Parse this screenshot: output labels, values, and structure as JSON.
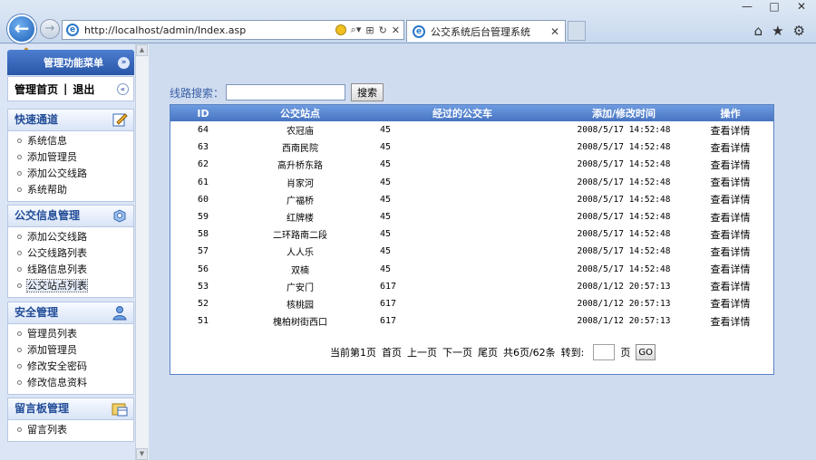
{
  "browser": {
    "address": "http://localhost/admin/Index.asp",
    "tab_title": "公交系统后台管理系统",
    "win_minimize": "—",
    "win_maximize": "□",
    "win_close": "✕"
  },
  "sidebar": {
    "menu_title": "管理功能菜单",
    "home_link": "管理首页",
    "link_separator": "|",
    "logout_link": "退出",
    "groups": [
      {
        "title": "快速通道",
        "items": [
          "系统信息",
          "添加管理员",
          "添加公交线路",
          "系统帮助"
        ]
      },
      {
        "title": "公交信息管理",
        "items": [
          "添加公交线路",
          "公交线路列表",
          "线路信息列表",
          "公交站点列表"
        ]
      },
      {
        "title": "安全管理",
        "items": [
          "管理员列表",
          "添加管理员",
          "修改安全密码",
          "修改信息资料"
        ]
      },
      {
        "title": "留言板管理",
        "items": [
          "留言列表"
        ]
      }
    ]
  },
  "search": {
    "label": "线路搜索：",
    "button": "搜索"
  },
  "table": {
    "columns": [
      "ID",
      "公交站点",
      "经过的公交车",
      "添加/修改时间",
      "操作"
    ],
    "rows": [
      {
        "id": "64",
        "name": "农冠庙",
        "bus": "45",
        "time": "2008/5/17 14:52:48",
        "op": "查看详情"
      },
      {
        "id": "63",
        "name": "西南民院",
        "bus": "45",
        "time": "2008/5/17 14:52:48",
        "op": "查看详情"
      },
      {
        "id": "62",
        "name": "高升桥东路",
        "bus": "45",
        "time": "2008/5/17 14:52:48",
        "op": "查看详情"
      },
      {
        "id": "61",
        "name": "肖家河",
        "bus": "45",
        "time": "2008/5/17 14:52:48",
        "op": "查看详情"
      },
      {
        "id": "60",
        "name": "广福桥",
        "bus": "45",
        "time": "2008/5/17 14:52:48",
        "op": "查看详情"
      },
      {
        "id": "59",
        "name": "红牌楼",
        "bus": "45",
        "time": "2008/5/17 14:52:48",
        "op": "查看详情"
      },
      {
        "id": "58",
        "name": "二环路南二段",
        "bus": "45",
        "time": "2008/5/17 14:52:48",
        "op": "查看详情"
      },
      {
        "id": "57",
        "name": "人人乐",
        "bus": "45",
        "time": "2008/5/17 14:52:48",
        "op": "查看详情"
      },
      {
        "id": "56",
        "name": "双楠",
        "bus": "45",
        "time": "2008/5/17 14:52:48",
        "op": "查看详情"
      },
      {
        "id": "53",
        "name": "广安门",
        "bus": "617",
        "time": "2008/1/12 20:57:13",
        "op": "查看详情"
      },
      {
        "id": "52",
        "name": "核桃园",
        "bus": "617",
        "time": "2008/1/12 20:57:13",
        "op": "查看详情"
      },
      {
        "id": "51",
        "name": "槐柏树街西口",
        "bus": "617",
        "time": "2008/1/12 20:57:13",
        "op": "查看详情"
      }
    ]
  },
  "pager": {
    "current": "当前第1页",
    "first": "首页",
    "prev": "上一页",
    "next": "下一页",
    "last": "尾页",
    "summary": "共6页/62条",
    "goto_label": "转到:",
    "page_unit": "页",
    "go_button": "GO"
  },
  "colors": {
    "accent": "#4774c2",
    "background": "#cfdcf0",
    "group_title": "#214c97"
  }
}
